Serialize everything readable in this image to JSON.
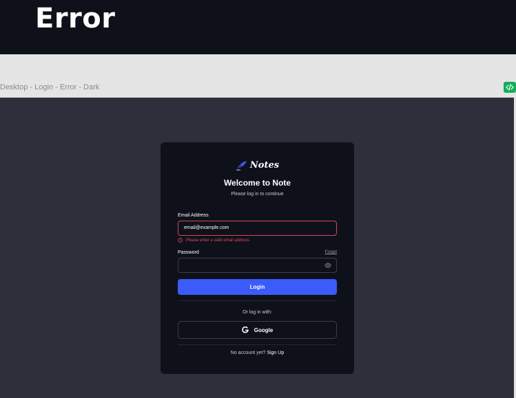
{
  "page": {
    "title": "Error",
    "frame_label": "Desktop - Login - Error - Dark"
  },
  "brand": {
    "name": "Notes",
    "accent_color": "#3b5bfb"
  },
  "login": {
    "welcome": "Welcome to Note",
    "subtitle": "Please log in to continue",
    "email_label": "Email Address",
    "email_value": "email@example.com",
    "email_error": "Please enter a valid email address.",
    "password_label": "Password",
    "forgot_label": "Forgot",
    "password_value": "",
    "login_label": "Login",
    "or_text": "Or log in with:",
    "google_label": "Google",
    "no_account_text": "No account yet?",
    "signup_label": "Sign Up"
  },
  "colors": {
    "error": "#e2475f",
    "card_bg": "#0e1119",
    "canvas_bg": "#2d303a",
    "badge": "#14ae5c"
  },
  "icons": [
    "feather-icon",
    "code-icon",
    "alert-circle-icon",
    "eye-icon",
    "google-icon"
  ]
}
